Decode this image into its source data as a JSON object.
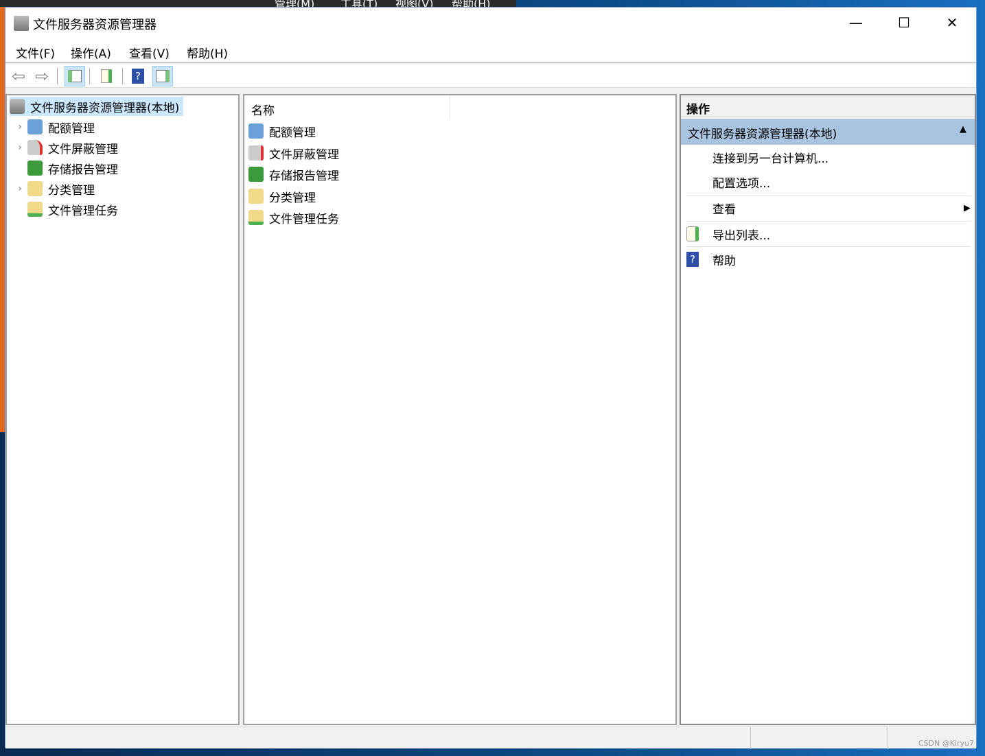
{
  "background_menu": [
    "管理(M)",
    "工具(T)",
    "视图(V)",
    "帮助(H)"
  ],
  "window": {
    "title": "文件服务器资源管理器",
    "minimize": "—",
    "maximize": "☐",
    "close": "✕"
  },
  "menu": [
    "文件(F)",
    "操作(A)",
    "查看(V)",
    "帮助(H)"
  ],
  "tree": {
    "root": "文件服务器资源管理器(本地)",
    "items": [
      "配额管理",
      "文件屏蔽管理",
      "存储报告管理",
      "分类管理",
      "文件管理任务"
    ]
  },
  "list": {
    "column": "名称",
    "items": [
      "配额管理",
      "文件屏蔽管理",
      "存储报告管理",
      "分类管理",
      "文件管理任务"
    ]
  },
  "actions": {
    "header": "操作",
    "section": "文件服务器资源管理器(本地)",
    "items": [
      "连接到另一台计算机...",
      "配置选项...",
      "查看",
      "导出列表...",
      "帮助"
    ]
  },
  "watermark": "CSDN @Kiryu7"
}
